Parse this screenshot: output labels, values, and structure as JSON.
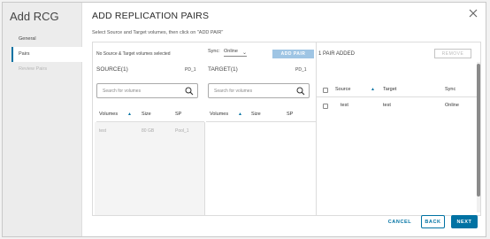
{
  "sidebar": {
    "title": "Add RCG",
    "steps": [
      {
        "label": "General"
      },
      {
        "label": "Pairs"
      },
      {
        "label": "Review Pairs"
      }
    ]
  },
  "header": {
    "title": "ADD REPLICATION PAIRS",
    "instruction": "Select Source and Target volumes, then click on \"ADD PAIR\""
  },
  "toolbar": {
    "selection_status": "No Source & Target volumes selected",
    "sync_label": "Sync:",
    "sync_value": "Online",
    "add_pair_label": "ADD PAIR"
  },
  "source": {
    "title": "SOURCE(1)",
    "pd": "PD_1",
    "search_placeholder": "Search for volumes",
    "columns": [
      "Volumes",
      "Size",
      "SP"
    ],
    "rows": [
      {
        "volume": "test",
        "size": "80 GB",
        "sp": "Pool_1"
      }
    ]
  },
  "target": {
    "title": "TARGET(1)",
    "pd": "PD_1",
    "search_placeholder": "Search for volumes",
    "columns": [
      "Volumes",
      "Size",
      "SP"
    ]
  },
  "pairs": {
    "count_label": "1 PAIR ADDED",
    "remove_label": "REMOVE",
    "columns": [
      "Source",
      "Target",
      "Sync"
    ],
    "rows": [
      {
        "source": "test",
        "target": "test",
        "sync": "Online"
      }
    ]
  },
  "footer": {
    "cancel_label": "CANCEL",
    "back_label": "BACK",
    "next_label": "NEXT"
  },
  "colors": {
    "primary": "#0072a3",
    "disabled_button": "#9fc5e4"
  }
}
